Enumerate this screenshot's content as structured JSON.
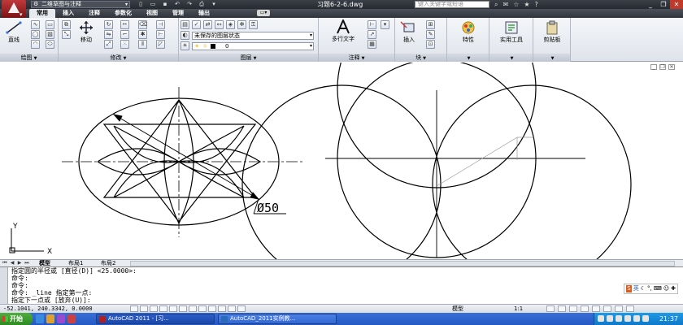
{
  "titlebar": {
    "workspace": "二维草图与注释",
    "document_title": "习题6-2-6.dwg",
    "search_placeholder": "键入关键字或短语"
  },
  "ribbon_tabs": [
    "常用",
    "插入",
    "注释",
    "参数化",
    "视图",
    "管理",
    "输出"
  ],
  "panels": {
    "draw": {
      "title": "绘图",
      "line_label": "直线"
    },
    "modify": {
      "title": "修改",
      "move_label": "移动"
    },
    "layers": {
      "title": "图层",
      "layer_state": "未保存的图层状态",
      "current_layer": "0"
    },
    "annotation": {
      "title": "注释",
      "mtext_label": "多行文字"
    },
    "block": {
      "title": "块",
      "insert_label": "插入"
    },
    "properties": {
      "label": "特性"
    },
    "utilities": {
      "label": "实用工具"
    },
    "clipboard": {
      "label": "剪贴板"
    }
  },
  "drawing": {
    "dimension_label": "Ø50",
    "ucs_x": "X",
    "ucs_y": "Y"
  },
  "layout_tabs": [
    "模型",
    "布局1",
    "布局2"
  ],
  "command_lines": [
    "指定圆的半径或 [直径(D)] <25.0000>:",
    "命令:",
    "命令:",
    "命令: _line 指定第一点:",
    "指定下一点或 [放弃(U)]:"
  ],
  "ime": {
    "logo": "S",
    "lang": "英"
  },
  "statusbar": {
    "coordinates": "-52.1041, 240.3342, 0.0000",
    "model": "模型",
    "scale": "1:1"
  },
  "taskbar": {
    "start": "开始",
    "tasks": [
      "AutoCAD 2011 - [习...",
      "AutoCAD_2011实例教..."
    ],
    "clock": "21:37"
  },
  "colors": {
    "title_bg": "#2c3038",
    "ribbon_bg": "#e6e9ee",
    "taskbar": "#2458c2",
    "start": "#3c9a2c"
  }
}
